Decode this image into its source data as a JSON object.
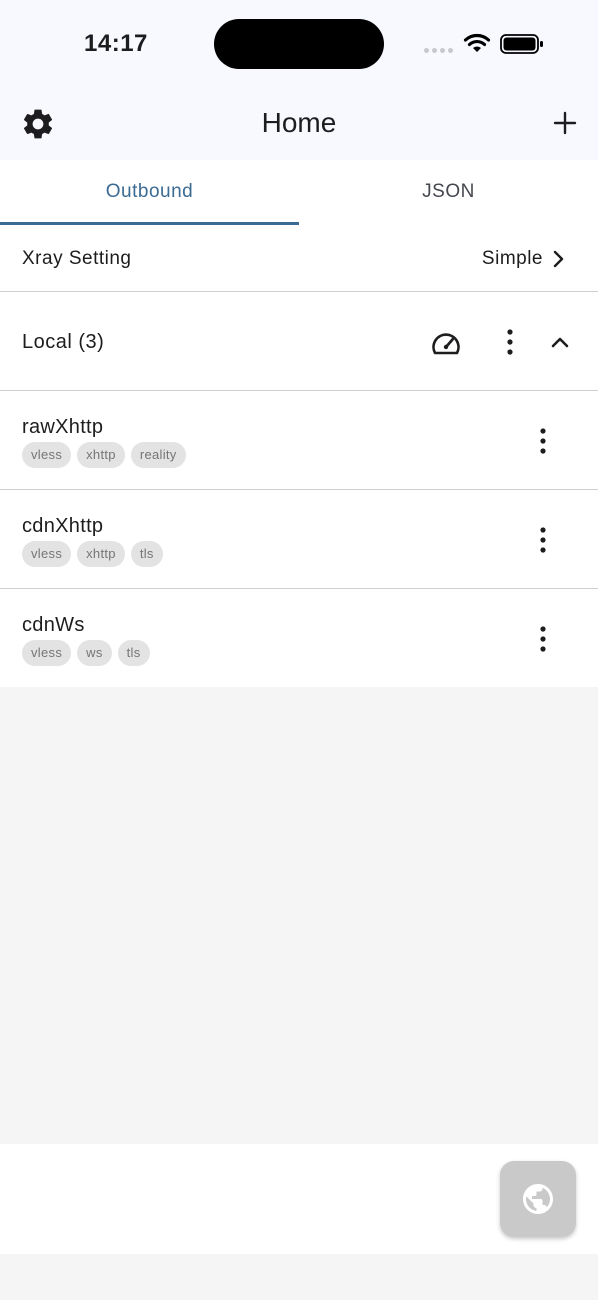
{
  "status_bar": {
    "time": "14:17"
  },
  "app_bar": {
    "title": "Home",
    "left_icon": "gear-icon",
    "right_icon": "plus-icon"
  },
  "tabs": [
    {
      "label": "Outbound",
      "selected": true
    },
    {
      "label": "JSON",
      "selected": false
    }
  ],
  "xray_setting": {
    "label": "Xray Setting",
    "value": "Simple"
  },
  "group": {
    "label": "Local (3)",
    "actions": [
      "speedometer-icon",
      "more-vertical-icon",
      "chevron-up-icon"
    ]
  },
  "outbounds": [
    {
      "name": "rawXhttp",
      "tags": [
        "vless",
        "xhttp",
        "reality"
      ]
    },
    {
      "name": "cdnXhttp",
      "tags": [
        "vless",
        "xhttp",
        "tls"
      ]
    },
    {
      "name": "cdnWs",
      "tags": [
        "vless",
        "ws",
        "tls"
      ]
    }
  ],
  "fab": {
    "icon": "globe-icon",
    "enabled": false
  },
  "colors": {
    "accent": "#3b6a92",
    "app_bar_bg": "#f8f9ff",
    "chip_bg": "#e3e3e3",
    "fab_bg": "#c9c9c9"
  }
}
